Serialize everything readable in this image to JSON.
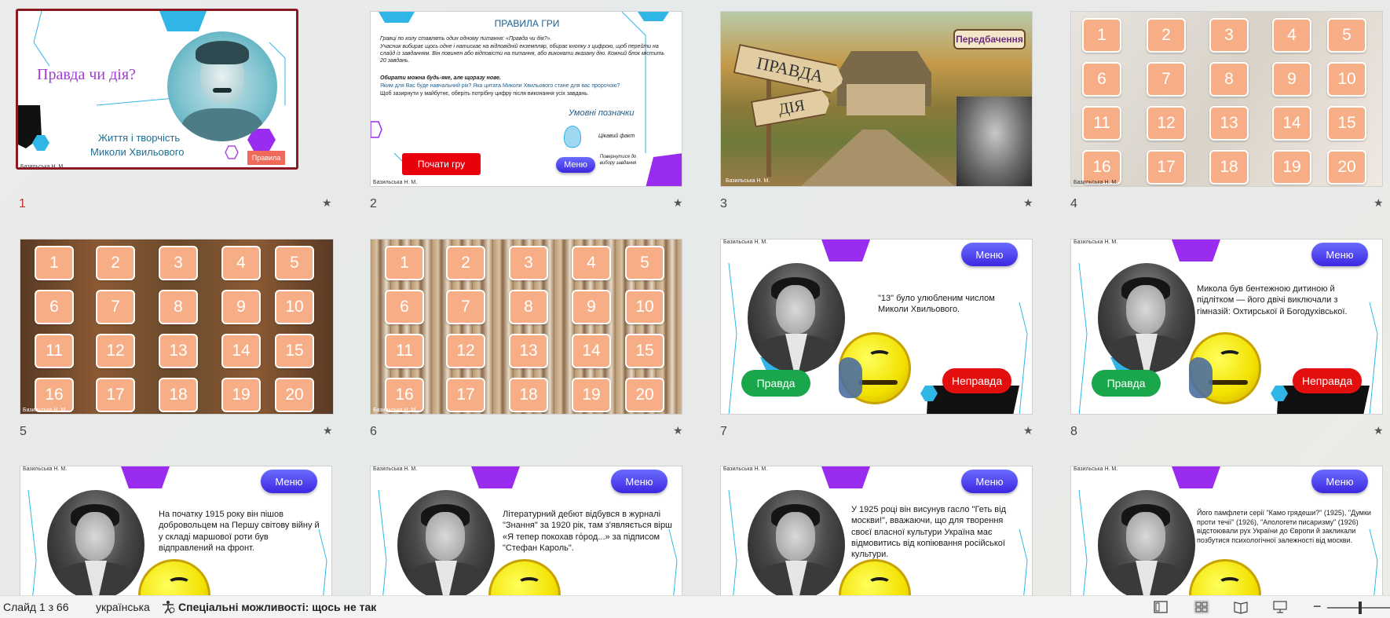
{
  "status_bar": {
    "slide_counter": "Слайд 1 з 66",
    "language": "українська",
    "accessibility": "Спеціальні можливості: щось не так"
  },
  "common": {
    "author": "Базильська Н. М.",
    "menu": "Меню",
    "true": "Правда",
    "false": "Неправда"
  },
  "slides": [
    {
      "num": "1",
      "title": "Правда чи дія?",
      "subtitle1": "Життя і творчість",
      "subtitle2": "Миколи Хвильового",
      "rules_btn": "Правила"
    },
    {
      "num": "2",
      "heading": "ПРАВИЛА ГРИ",
      "p1": "Гравці по колу ставлять один одному питання: «Правда чи дія?».",
      "p2": "Учасник вибирає щось одне і натискає на відповідній екземпляр, обирає кнопку з цифрою, щоб перейти на слайд із завданням. Він повинен або відповісти на питання, або виконати вказану дію. Кожний блок містить 20 завдань.",
      "p3": "Обирати можна будь-яке, але щоразу нове.",
      "p4": "Яким для Вас буде навчальний рік? Яка цитата Миколи Хвильового стане для вас пророчою?",
      "p5": "Щоб зазирнути у майбутнє, оберіть потрібну цифру після виконання усіх завдань.",
      "legend_title": "Умовні позначки",
      "legend_fact": "Цікавий факт",
      "legend_back": "Повернутися до вибору завдання",
      "start_btn": "Почати гру"
    },
    {
      "num": "3",
      "sign_top": "Передбачення",
      "sign1": "ПРАВДА",
      "sign2": "ДІЯ"
    },
    {
      "num": "4"
    },
    {
      "num": "5"
    },
    {
      "num": "6"
    },
    {
      "num": "7",
      "text": "\"13\" було улюбленим числом Миколи Хвильового."
    },
    {
      "num": "8",
      "text": "Микола був бентежною дитиною й підлітком — його двічі виключали з гімназій: Охтирської й Богодухівської."
    },
    {
      "num": "9",
      "text": "На початку 1915 року він пішов добровольцем на Першу світову війну й у складі маршової роти був відправлений на фронт."
    },
    {
      "num": "10",
      "text": "Літературний дебют відбувся в журналі \"Знання\" за 1920 рік, там з'являється вірш «Я тепер покохав гόрод...» за підписом \"Стефан Кароль\"."
    },
    {
      "num": "11",
      "text": "У 1925 році він висунув гасло \"Геть від москви!\", вважаючи, що для творення своєї власної культури Україна має відмовитись від копіювання російської культури."
    },
    {
      "num": "12",
      "text": "Його памфлети серії \"Камо грядеши?\" (1925), \"Думки проти течії\" (1926), \"Апологети писаризму\" (1926) відстоювали рух України до Європи й закликали позбутися психологічної залежності від москви."
    }
  ],
  "tiles": [
    "1",
    "2",
    "3",
    "4",
    "5",
    "6",
    "7",
    "8",
    "9",
    "10",
    "11",
    "12",
    "13",
    "14",
    "15",
    "16",
    "17",
    "18",
    "19",
    "20"
  ]
}
